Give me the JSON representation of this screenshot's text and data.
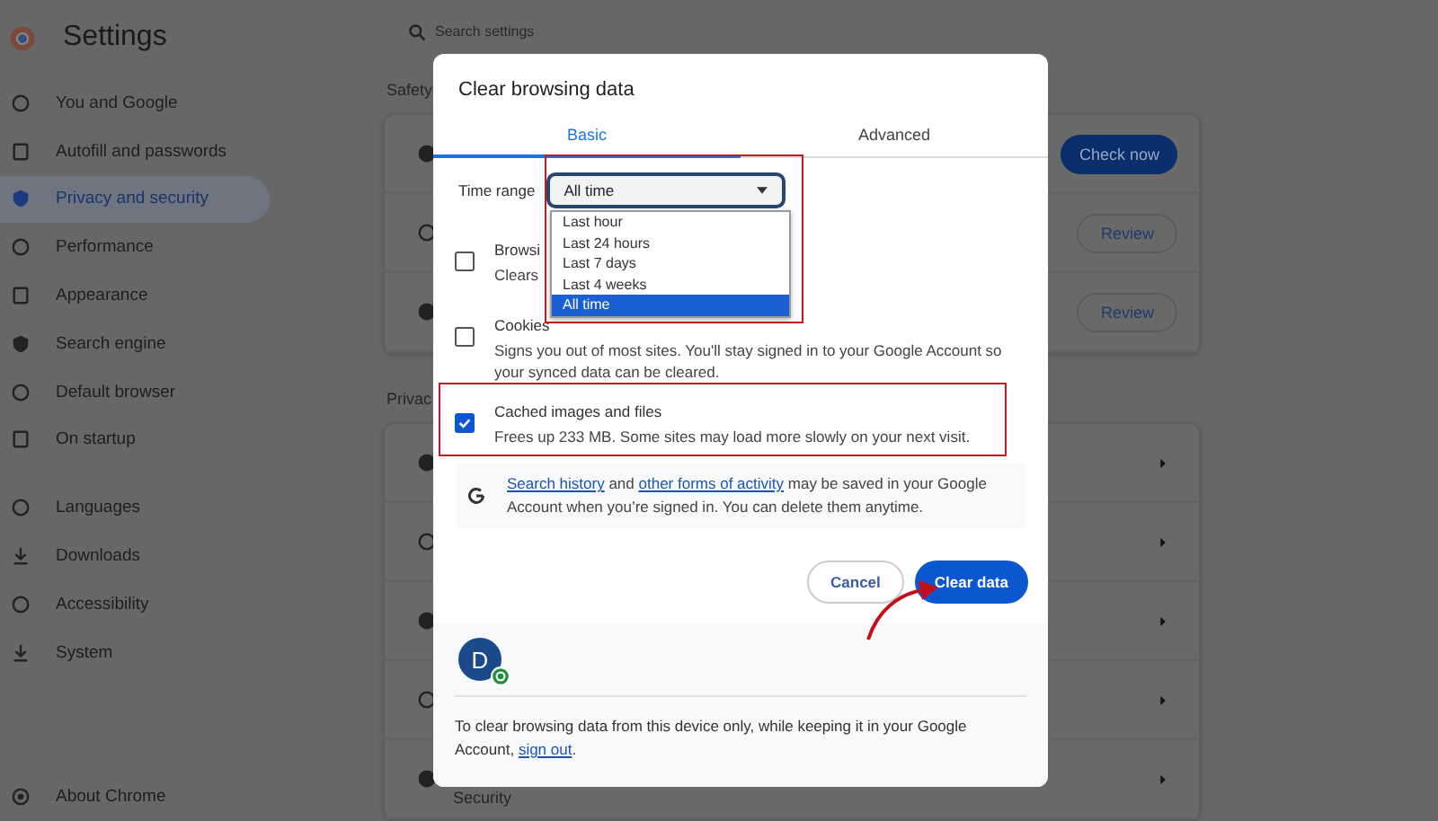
{
  "sidebar": {
    "title": "Settings",
    "items": [
      {
        "label": "You and Google",
        "selected": false
      },
      {
        "label": "Autofill and passwords",
        "selected": false
      },
      {
        "label": "Privacy and security",
        "selected": true
      },
      {
        "label": "Performance",
        "selected": false
      },
      {
        "label": "Appearance",
        "selected": false
      },
      {
        "label": "Search engine",
        "selected": false
      },
      {
        "label": "Default browser",
        "selected": false
      },
      {
        "label": "On startup",
        "selected": false
      }
    ],
    "items_2": [
      {
        "label": "Languages",
        "selected": false
      },
      {
        "label": "Downloads",
        "selected": false
      },
      {
        "label": "Accessibility",
        "selected": false
      },
      {
        "label": "System",
        "selected": false
      }
    ],
    "footer_item": "About Chrome"
  },
  "search": {
    "placeholder": "Search settings"
  },
  "sections": [
    {
      "heading": "Safety",
      "rows": [
        {
          "kind": "primary",
          "button": "Check now"
        },
        {
          "kind": "outline",
          "button": "Review"
        },
        {
          "kind": "outline",
          "button": "Review"
        }
      ]
    },
    {
      "heading": "Privac",
      "rows": [
        {
          "kind": "chevron"
        },
        {
          "kind": "chevron"
        },
        {
          "kind": "chevron"
        },
        {
          "kind": "chevron"
        },
        {
          "kind": "chevron"
        }
      ]
    }
  ],
  "bottom_heading": "Security",
  "dialog": {
    "title": "Clear browsing data",
    "tabs": [
      {
        "label": "Basic",
        "selected": true
      },
      {
        "label": "Advanced",
        "selected": false
      }
    ],
    "time_range": {
      "label": "Time range",
      "value": "All time",
      "expanded": true,
      "options": [
        {
          "label": "Last hour",
          "selected": false
        },
        {
          "label": "Last 24 hours",
          "selected": false
        },
        {
          "label": "Last 7 days",
          "selected": false
        },
        {
          "label": "Last 4 weeks",
          "selected": false
        },
        {
          "label": "All time",
          "selected": true
        }
      ]
    },
    "items": [
      {
        "label": "Browsi",
        "description": "Clears",
        "checked": false
      },
      {
        "label": "Cookies",
        "description": "Signs you out of most sites. You'll stay signed in to your Google Account so your synced data can be cleared.",
        "checked": false
      },
      {
        "label": "Cached images and files",
        "description": "Frees up 233 MB. Some sites may load more slowly on your next visit.",
        "checked": true
      }
    ],
    "info": [
      {
        "text": "Search history",
        "kind": "link"
      },
      {
        "text": " and ",
        "kind": "text"
      },
      {
        "text": "other forms of activity",
        "kind": "link"
      },
      {
        "text": " may be saved in your Google Account when you’re signed in. You can delete them anytime.",
        "kind": "text"
      }
    ],
    "buttons": [
      {
        "label": "Cancel",
        "kind": "secondary"
      },
      {
        "label": "Clear data",
        "kind": "primary"
      }
    ],
    "account_initial": "D",
    "footer": [
      {
        "text": "To clear browsing data from this device only, while keeping it in your Google Account, ",
        "kind": "text"
      },
      {
        "text": "sign out",
        "kind": "link"
      },
      {
        "text": ".",
        "kind": "text"
      }
    ]
  }
}
